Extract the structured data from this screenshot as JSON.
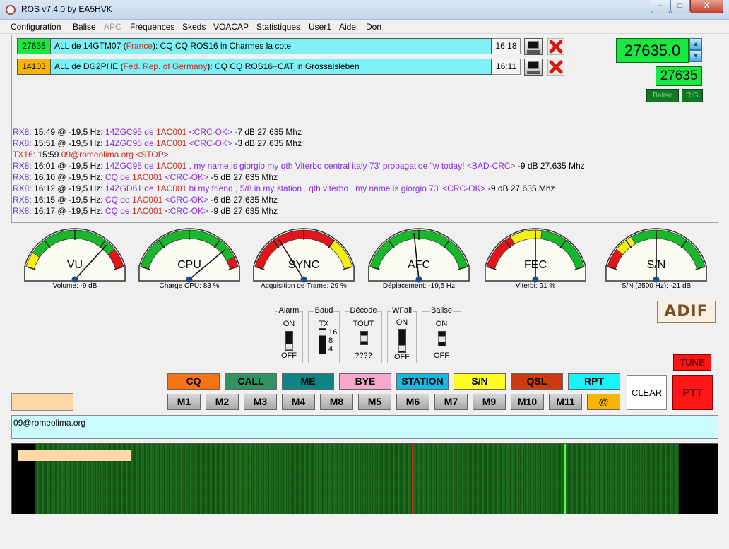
{
  "window": {
    "title": "ROS v7.4.0 by EA5HVK",
    "min": "–",
    "max": "□",
    "close": "X"
  },
  "menu": [
    {
      "label": "Configuration",
      "disabled": false
    },
    {
      "label": "Balise",
      "disabled": false
    },
    {
      "label": "APC",
      "disabled": true
    },
    {
      "label": "Fréquences",
      "disabled": false
    },
    {
      "label": "Skeds",
      "disabled": false
    },
    {
      "label": "VOACAP",
      "disabled": false
    },
    {
      "label": "Statistiques",
      "disabled": false
    },
    {
      "label": "User1",
      "disabled": false
    },
    {
      "label": "Aide",
      "disabled": false
    },
    {
      "label": "Don",
      "disabled": false
    }
  ],
  "calls": [
    {
      "freq": "27635",
      "freq_color": "#19e83e",
      "pre": "ALL de 14GTM07 (",
      "country": "France",
      "post": "): CQ CQ ROS16 in Charmes la cote",
      "time": "16:18"
    },
    {
      "freq": "14103",
      "freq_color": "#f7b500",
      "pre": "ALL de DG2PHE (",
      "country": "Fed. Rep. of Germany",
      "post": "): CQ CQ ROS16+CAT in Grossalsleben",
      "time": "16:11"
    }
  ],
  "frequency": {
    "main": "27635.0",
    "rig": "27635",
    "up": "▲",
    "down": "▼",
    "balise_btn": "Balise",
    "rig_btn": "RIG"
  },
  "log": [
    {
      "type": "RX8:",
      "time": " 15:49 @ -19,5 Hz: ",
      "call": "14ZGC95",
      "de": " de ",
      "src": "1AC001",
      "msg": "  <CRC-OK>",
      "tail": " -7 dB  27.635 Mhz"
    },
    {
      "type": "RX8:",
      "time": " 15:51 @ -19,5 Hz: ",
      "call": "14ZGC95",
      "de": " de ",
      "src": "1AC001",
      "msg": "  <CRC-OK>",
      "tail": " -3 dB  27.635 Mhz"
    },
    {
      "type": "TX16:",
      "time": " 15:59 ",
      "call": "",
      "de": "",
      "src": "09@romeolima.org",
      "msg": "  <STOP>",
      "tail": ""
    },
    {
      "type": "RX8:",
      "time": " 16:01 @ -19,5 Hz: ",
      "call": "14ZGC95",
      "de": " de ",
      "src": "1AC001",
      "msg": " , my name is giorgio my qth Viterbo central italy 73' propagatioe \"w today! <BAD-CRC>",
      "tail": " -9 dB  27.635 Mhz"
    },
    {
      "type": "RX8:",
      "time": " 16:10 @ -19,5 Hz: ",
      "call": "CQ",
      "de": " de ",
      "src": "1AC001",
      "msg": "  <CRC-OK>",
      "tail": " -5 dB  27.635 Mhz"
    },
    {
      "type": "RX8:",
      "time": " 16:12 @ -19,5 Hz: ",
      "call": "14ZGD61",
      "de": " de ",
      "src": "1AC001",
      "msg": "  hi my friend , 5/8 in my station . qth viterbo , my name is giorgio 73' <CRC-OK>",
      "tail": " -9 dB  27.635 Mhz"
    },
    {
      "type": "RX8:",
      "time": " 16:15 @ -19,5 Hz: ",
      "call": "CQ",
      "de": " de ",
      "src": "1AC001",
      "msg": "  <CRC-OK>",
      "tail": " -6 dB  27.635 Mhz"
    },
    {
      "type": "RX8:",
      "time": " 16:17 @ -19,5 Hz: ",
      "call": "CQ",
      "de": " de ",
      "src": "1AC001",
      "msg": "  <CRC-OK>",
      "tail": " -9 dB  27.635 Mhz"
    }
  ],
  "gauges": [
    {
      "label": "VU",
      "caption": "Volume: -9 dB",
      "needle": 0.78,
      "zones": "vu"
    },
    {
      "label": "CPU",
      "caption": "Charge CPU: 83 %",
      "needle": 0.83,
      "zones": "cpu"
    },
    {
      "label": "SYNC",
      "caption": "Acquisition de Trame: 29 %",
      "needle": 0.29,
      "zones": "sync"
    },
    {
      "label": "AFC",
      "caption": "Déplacement: -19,5 Hz",
      "needle": 0.46,
      "zones": "afc"
    },
    {
      "label": "FEC",
      "caption": "Viterbi: 91 %",
      "needle": 0.5,
      "zones": "fec"
    },
    {
      "label": "S/N",
      "caption": "S/N (2500 Hz): -21 dB",
      "needle": 0.5,
      "zones": "sn"
    }
  ],
  "switches": {
    "alarm": {
      "title": "Alarm",
      "on": "ON",
      "off": "OFF",
      "level": 0
    },
    "baud": {
      "title": "Baud",
      "tx": "TX",
      "v16": "16",
      "v8": "8",
      "v4": "4",
      "level": 1
    },
    "decode": {
      "title": "Décode",
      "top": "TOUT",
      "bottom": "????",
      "level": 0.5
    },
    "wfall": {
      "title": "WFall",
      "on": "ON",
      "off": "OFF",
      "level": 0
    },
    "balise": {
      "title": "Balise",
      "on": "ON",
      "off": "OFF",
      "level": 0.5
    }
  },
  "macros": [
    {
      "label": "CQ",
      "color": "#f87216"
    },
    {
      "label": "CALL",
      "color": "#319262"
    },
    {
      "label": "ME",
      "color": "#0f8484"
    },
    {
      "label": "BYE",
      "color": "#f7a8cc"
    },
    {
      "label": "STATION",
      "color": "#17b8e3"
    },
    {
      "label": "S/N",
      "color": "#ffff22"
    },
    {
      "label": "QSL",
      "color": "#cc3a10"
    },
    {
      "label": "RPT",
      "color": "#17f3ff"
    }
  ],
  "memories": [
    "M1",
    "M2",
    "M3",
    "M4",
    "M8",
    "M5",
    "M6",
    "M7",
    "M9",
    "M10",
    "M11",
    "@"
  ],
  "controls": {
    "adif": "ADIF",
    "tune": "TUNE",
    "clear": "CLEAR",
    "ptt": "PTT"
  },
  "tx_text": "09@romeolima.org"
}
